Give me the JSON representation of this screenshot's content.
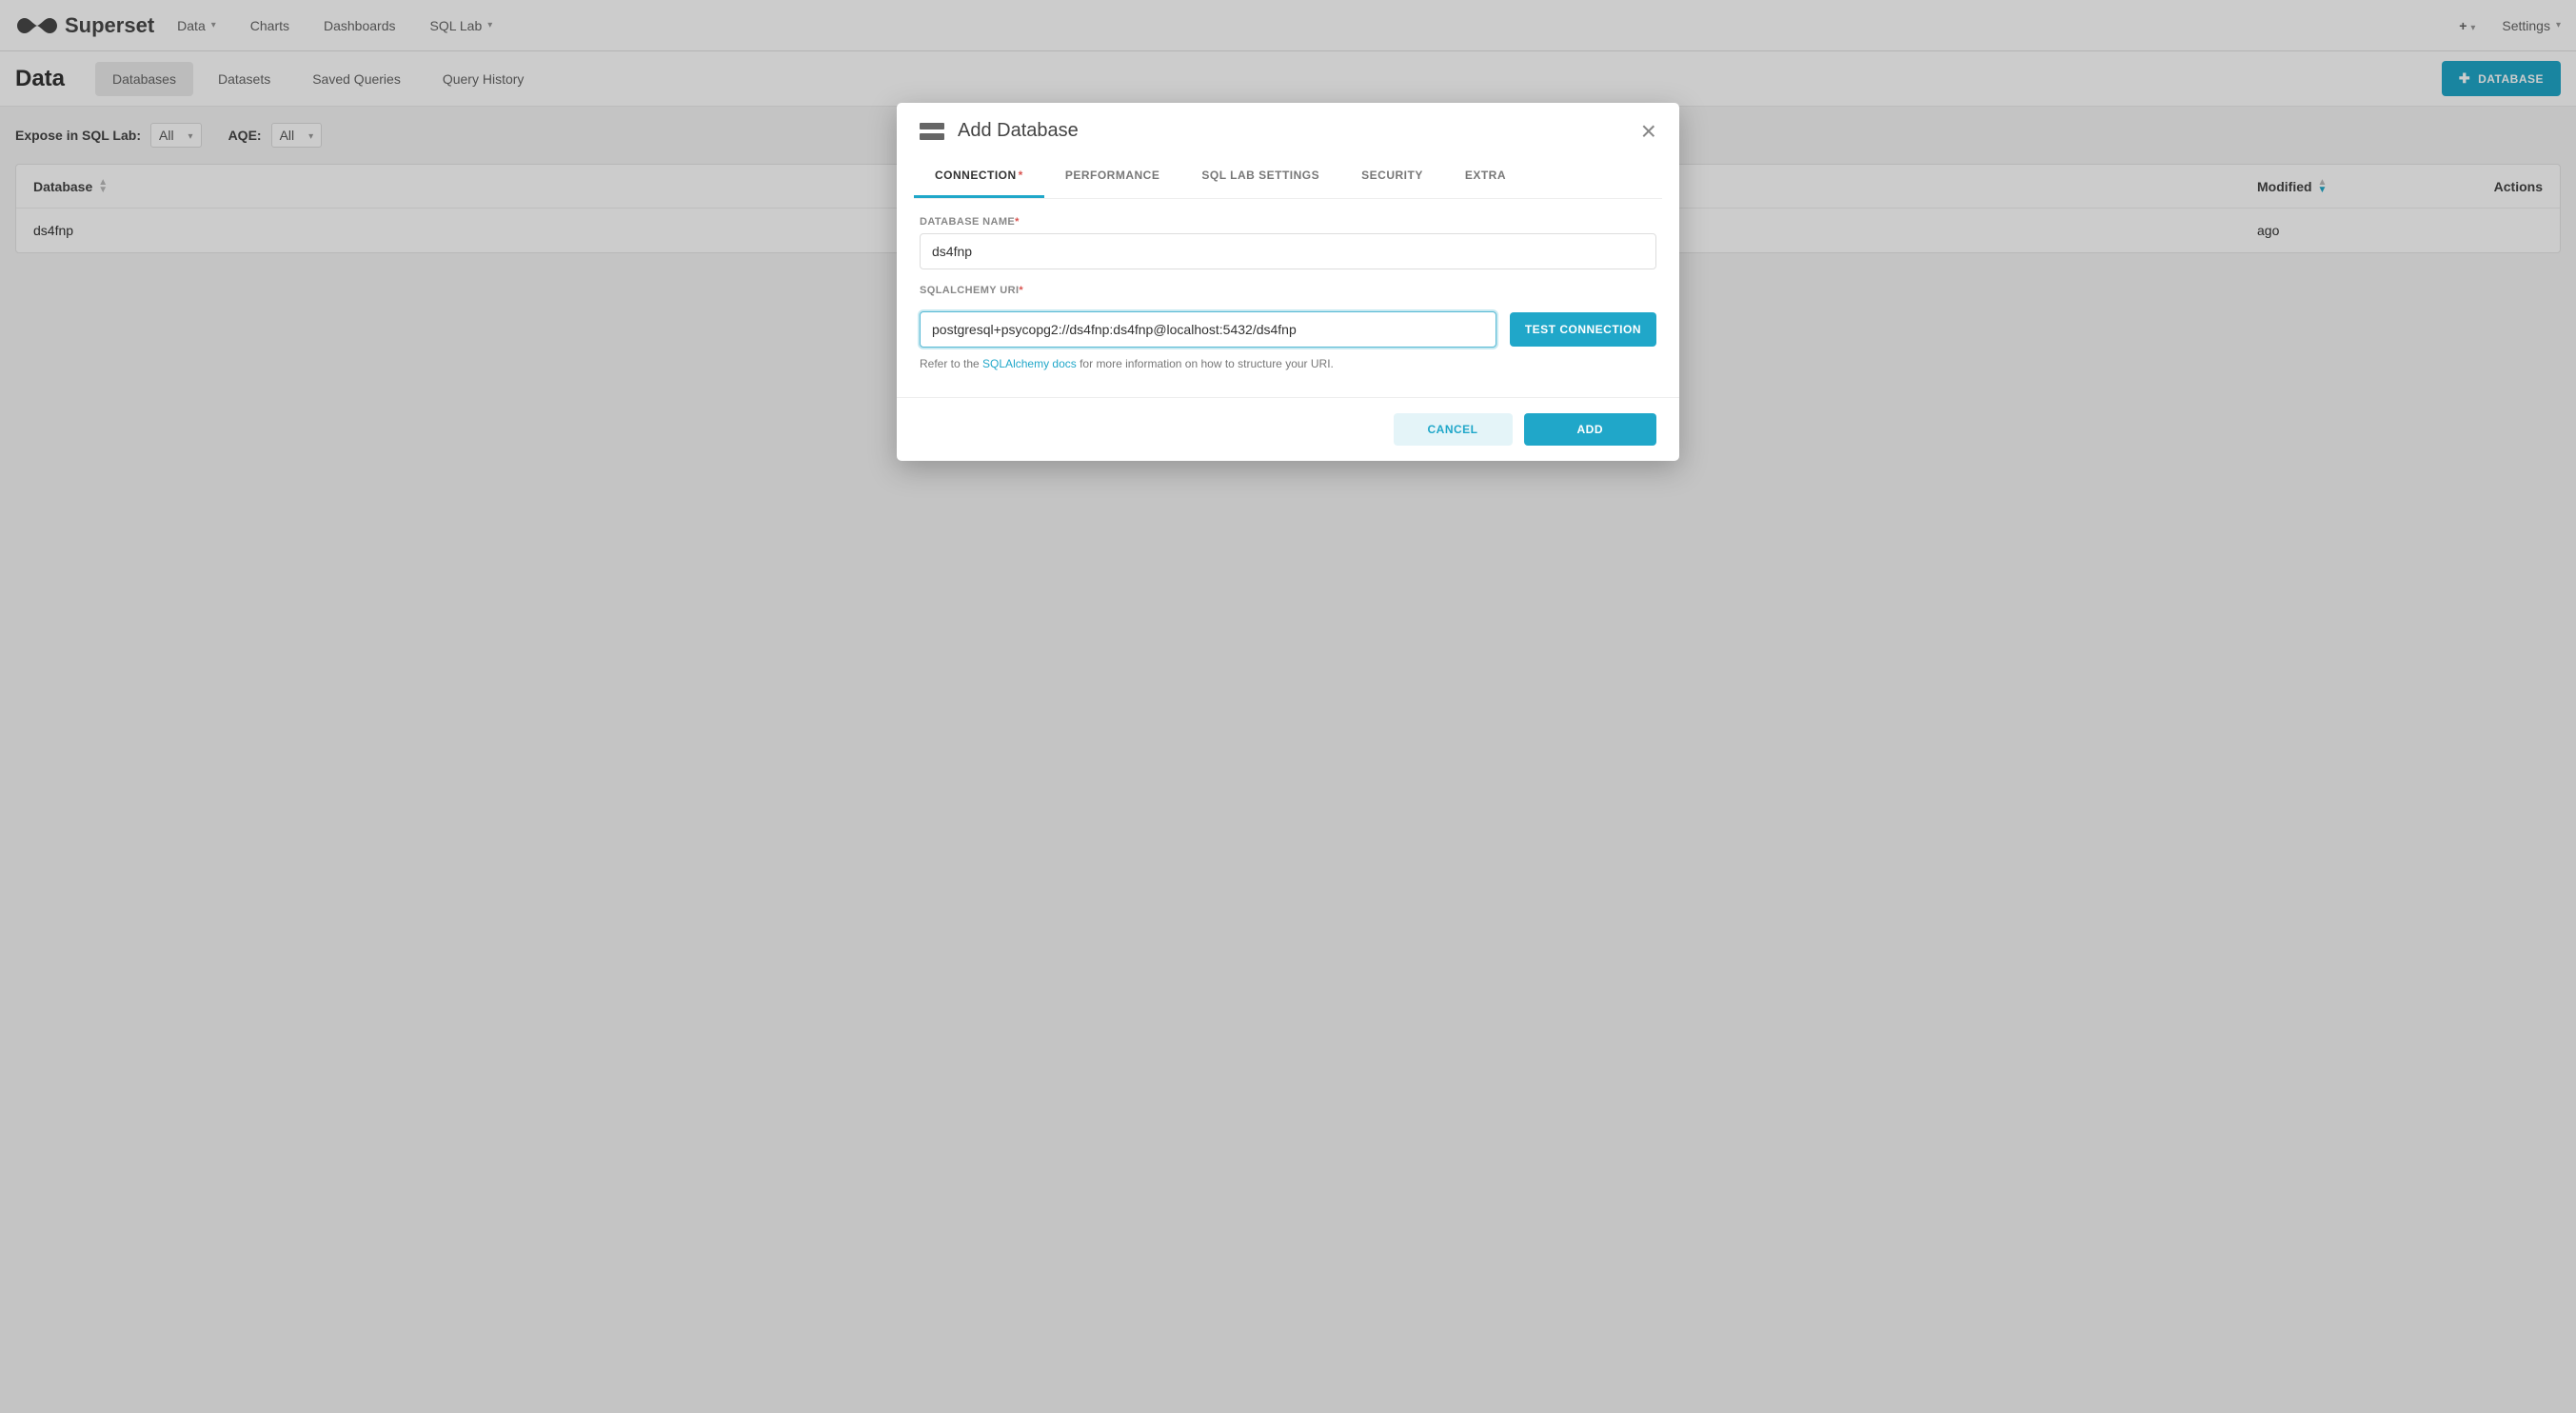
{
  "brand": {
    "name": "Superset"
  },
  "nav": {
    "items": [
      {
        "label": "Data",
        "has_caret": true
      },
      {
        "label": "Charts",
        "has_caret": false
      },
      {
        "label": "Dashboards",
        "has_caret": false
      },
      {
        "label": "SQL Lab",
        "has_caret": true
      }
    ],
    "settings_label": "Settings"
  },
  "subheader": {
    "title": "Data",
    "tabs": [
      {
        "label": "Databases",
        "active": true
      },
      {
        "label": "Datasets",
        "active": false
      },
      {
        "label": "Saved Queries",
        "active": false
      },
      {
        "label": "Query History",
        "active": false
      }
    ],
    "add_button_label": "DATABASE"
  },
  "filters": {
    "expose_label": "Expose in SQL Lab:",
    "expose_value": "All",
    "aqe_label": "AQE:",
    "aqe_value": "All"
  },
  "table": {
    "columns": {
      "database": "Database",
      "modified": "Modified",
      "actions": "Actions"
    },
    "rows": [
      {
        "database": "ds4fnp",
        "modified": "ago"
      }
    ]
  },
  "modal": {
    "title": "Add Database",
    "tabs": {
      "connection": "CONNECTION",
      "performance": "PERFORMANCE",
      "sql_lab": "SQL LAB SETTINGS",
      "security": "SECURITY",
      "extra": "EXTRA"
    },
    "fields": {
      "db_name_label": "DATABASE NAME",
      "db_name_value": "ds4fnp",
      "uri_label": "SQLALCHEMY URI",
      "uri_value": "postgresql+psycopg2://ds4fnp:ds4fnp@localhost:5432/ds4fnp"
    },
    "test_button": "TEST CONNECTION",
    "hint_prefix": "Refer to the ",
    "hint_link": "SQLAlchemy docs",
    "hint_suffix": " for more information on how to structure your URI.",
    "cancel": "CANCEL",
    "add": "ADD"
  },
  "colors": {
    "accent": "#20a7c9"
  }
}
